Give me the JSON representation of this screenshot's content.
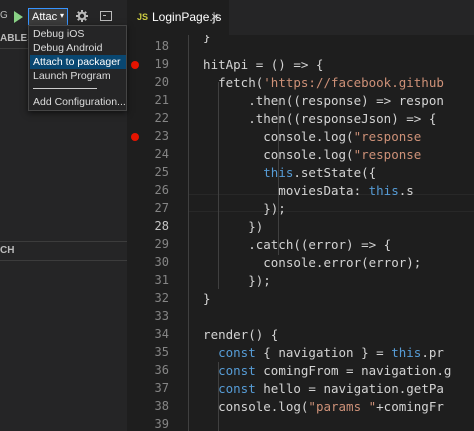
{
  "debug_toolbar": {
    "cut_label": "G",
    "config_value": "Attac",
    "caret": "▾",
    "icons": [
      "play-icon",
      "gear-icon",
      "console-icon"
    ]
  },
  "sidebar": {
    "variables_header": "ABLES",
    "watch_header": "CH"
  },
  "dropdown": {
    "options": [
      "Debug iOS",
      "Debug Android",
      "Attach to packager",
      "Launch Program"
    ],
    "separator": "───────",
    "add_configuration": "Add Configuration...",
    "selected_index": 2
  },
  "tab": {
    "lang_badge": "JS",
    "file_name": "LoginPage.js",
    "close": "×"
  },
  "editor": {
    "current_line": 28,
    "breakpoints": [
      19,
      23
    ],
    "lines": [
      {
        "n": "",
        "c": "  }"
      },
      {
        "n": "18",
        "c": ""
      },
      {
        "n": "19",
        "c": "  hitApi = () => {"
      },
      {
        "n": "20",
        "c": "    fetch('https://facebook.github"
      },
      {
        "n": "21",
        "c": "        .then((response) => respon"
      },
      {
        "n": "22",
        "c": "        .then((responseJson) => {"
      },
      {
        "n": "23",
        "c": "          console.log(\"response"
      },
      {
        "n": "24",
        "c": "          console.log(\"response"
      },
      {
        "n": "25",
        "c": "          this.setState({"
      },
      {
        "n": "26",
        "c": "            moviesData: this.s"
      },
      {
        "n": "27",
        "c": "          });"
      },
      {
        "n": "28",
        "c": "        })"
      },
      {
        "n": "29",
        "c": "        .catch((error) => {"
      },
      {
        "n": "30",
        "c": "          console.error(error);"
      },
      {
        "n": "31",
        "c": "        });"
      },
      {
        "n": "32",
        "c": "  }"
      },
      {
        "n": "33",
        "c": ""
      },
      {
        "n": "34",
        "c": "  render() {"
      },
      {
        "n": "35",
        "c": "    const { navigation } = this.pr"
      },
      {
        "n": "36",
        "c": "    const comingFrom = navigation.g"
      },
      {
        "n": "37",
        "c": "    const hello = navigation.getPa"
      },
      {
        "n": "38",
        "c": "    console.log(\"params \"+comingFr"
      },
      {
        "n": "39",
        "c": ""
      }
    ]
  },
  "colors": {
    "keyword": "#569cd6",
    "string": "#ce9178",
    "breakpoint": "#e51400",
    "selection": "#094771"
  }
}
